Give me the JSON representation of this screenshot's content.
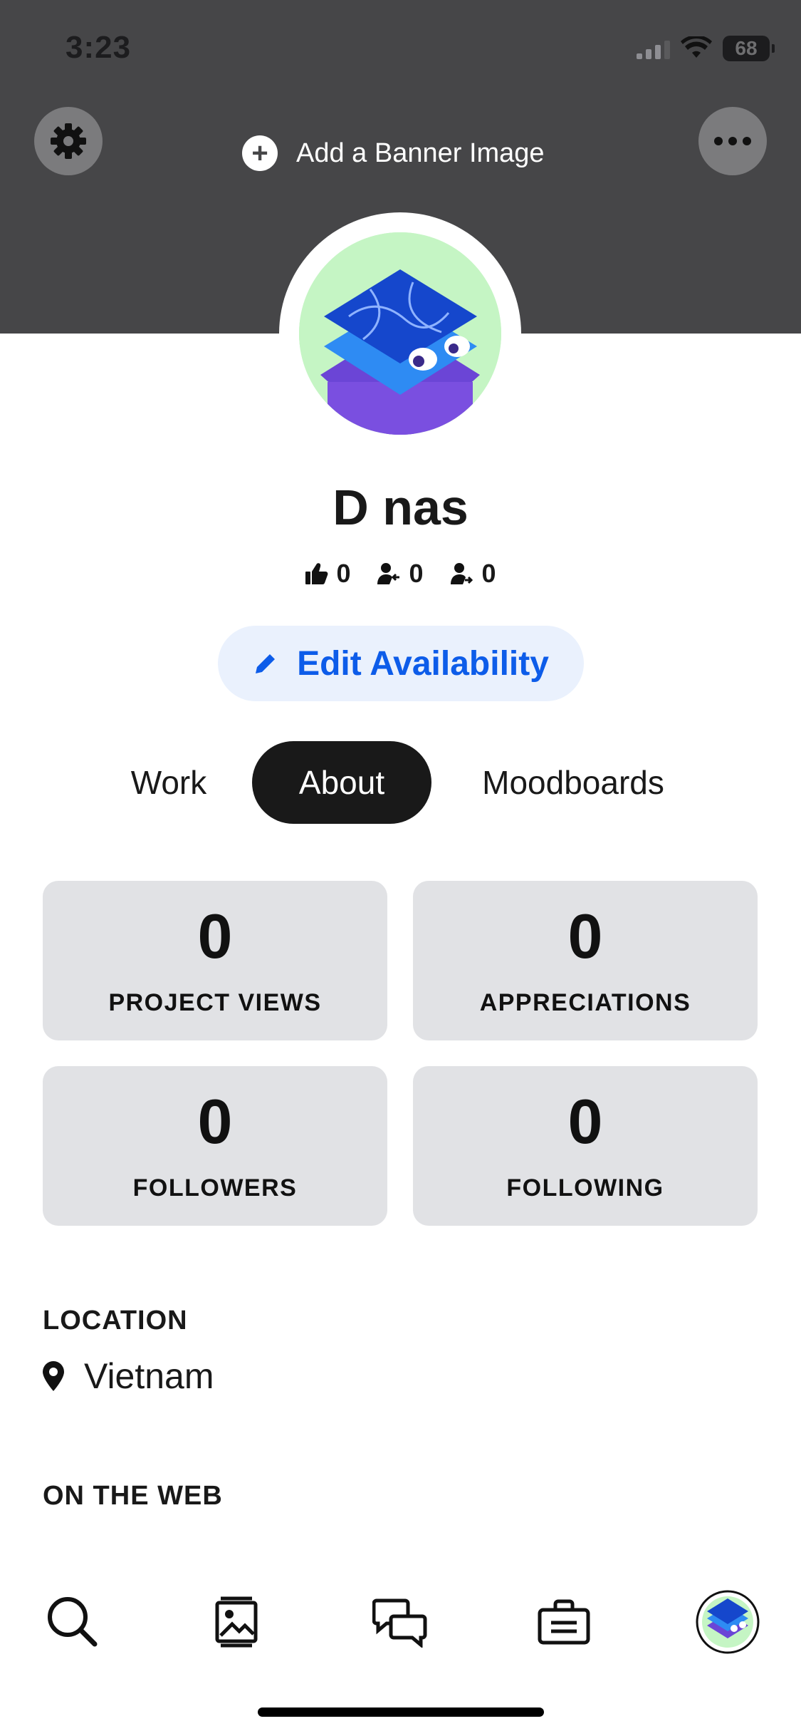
{
  "status_bar": {
    "time": "3:23",
    "battery": "68"
  },
  "banner": {
    "add_label": "Add a Banner Image"
  },
  "profile": {
    "name": "D nas",
    "appreciations": "0",
    "followers": "0",
    "following": "0",
    "edit_availability_label": "Edit Availability"
  },
  "tabs": [
    {
      "label": "Work",
      "active": false
    },
    {
      "label": "About",
      "active": true
    },
    {
      "label": "Moodboards",
      "active": false
    }
  ],
  "stats": [
    {
      "value": "0",
      "label": "PROJECT VIEWS"
    },
    {
      "value": "0",
      "label": "APPRECIATIONS"
    },
    {
      "value": "0",
      "label": "FOLLOWERS"
    },
    {
      "value": "0",
      "label": "FOLLOWING"
    }
  ],
  "location": {
    "title": "LOCATION",
    "value": "Vietnam"
  },
  "on_the_web": {
    "title": "ON THE WEB"
  },
  "bottom_nav": [
    {
      "icon": "search-icon"
    },
    {
      "icon": "gallery-icon"
    },
    {
      "icon": "messages-icon"
    },
    {
      "icon": "jobs-briefcase-icon"
    },
    {
      "icon": "profile-avatar-icon"
    }
  ],
  "colors": {
    "accent": "#0d5ce9",
    "banner": "#464648",
    "card": "#e1e2e5",
    "tab_active": "#191919"
  }
}
